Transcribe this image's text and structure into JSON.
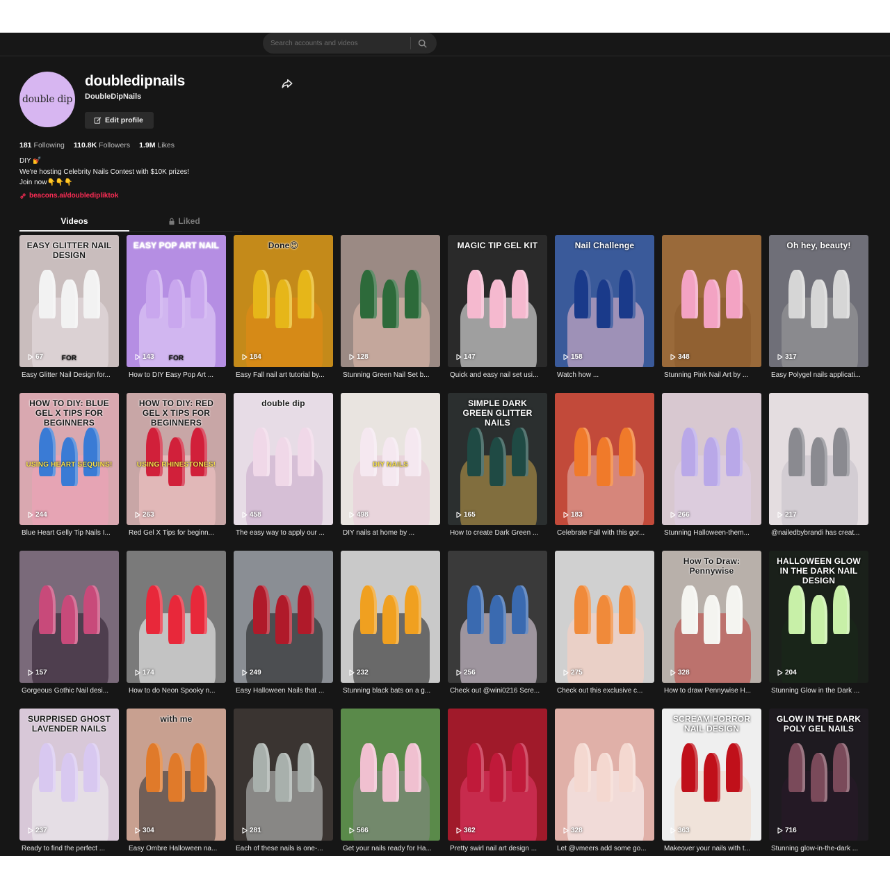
{
  "search": {
    "placeholder": "Search accounts and videos"
  },
  "profile": {
    "avatar_text": "double dip",
    "username": "doubledipnails",
    "nickname": "DoubleDipNails",
    "edit_label": "Edit profile"
  },
  "stats": {
    "following": "181",
    "following_label": "Following",
    "followers": "110.8K",
    "followers_label": "Followers",
    "likes": "1.9M",
    "likes_label": "Likes"
  },
  "bio": {
    "line1": "DIY 💅",
    "line2": "We're hosting Celebrity Nails Contest with $10K prizes!",
    "line3": "Join now👇👇👇",
    "link": "beacons.ai/doubledipliktok"
  },
  "tabs": {
    "videos": "Videos",
    "liked": "Liked"
  },
  "videos": [
    {
      "views": "67",
      "caption": "Easy Glitter Nail Design for...",
      "bg": "#c9bdbd",
      "overlay": "EASY GLITTER NAIL DESIGN",
      "overlay2": "FOR"
    },
    {
      "views": "143",
      "caption": "How to DIY Easy Pop Art ...",
      "bg": "#b58ee3",
      "overlay": "EASY POP ART NAIL",
      "overlay2": "FOR"
    },
    {
      "views": "184",
      "caption": "Easy Fall nail art tutorial by...",
      "bg": "#c48a1a",
      "overlay": "Done😍",
      "overlay2": ""
    },
    {
      "views": "128",
      "caption": "Stunning Green Nail Set b...",
      "bg": "#9b8a84",
      "overlay": "",
      "overlay2": ""
    },
    {
      "views": "147",
      "caption": "Quick and easy nail set usi...",
      "bg": "#2a2a2a",
      "overlay": "MAGIC TIP GEL KIT",
      "overlay2": ""
    },
    {
      "views": "158",
      "caption": "Watch how ...",
      "bg": "#3a5a9a",
      "overlay": "Nail Challenge",
      "overlay2": ""
    },
    {
      "views": "348",
      "caption": "Stunning Pink Nail Art by ...",
      "bg": "#9a6a3a",
      "overlay": "",
      "overlay2": ""
    },
    {
      "views": "317",
      "caption": "Easy Polygel nails applicati...",
      "bg": "#6f6f78",
      "overlay": "Oh hey, beauty!",
      "overlay2": ""
    },
    {
      "views": "244",
      "caption": "Blue Heart Gelly Tip Nails I...",
      "bg": "#d9a8b0",
      "overlay": "HOW TO DIY: BLUE GEL X TIPS FOR BEGINNERS",
      "overlay2": "USING HEART SEQUINS!"
    },
    {
      "views": "263",
      "caption": "Red Gel X Tips for beginn...",
      "bg": "#c8a6a6",
      "overlay": "HOW TO DIY: RED GEL X TIPS FOR BEGINNERS",
      "overlay2": "USING RHINESTONES!"
    },
    {
      "views": "458",
      "caption": "The easy way to apply our ...",
      "bg": "#e7dce6",
      "overlay": "double dip",
      "overlay2": ""
    },
    {
      "views": "498",
      "caption": "DIY nails at home by ...",
      "bg": "#e9e4e0",
      "overlay": "",
      "overlay2": "DIY NAILS"
    },
    {
      "views": "165",
      "caption": "How to create Dark Green ...",
      "bg": "#2b2f2f",
      "overlay": "SIMPLE DARK GREEN GLITTER NAILS",
      "overlay2": ""
    },
    {
      "views": "183",
      "caption": "Celebrate Fall with this gor...",
      "bg": "#c24a3a",
      "overlay": "",
      "overlay2": ""
    },
    {
      "views": "266",
      "caption": "Stunning Halloween-them...",
      "bg": "#d8c8d0",
      "overlay": "",
      "overlay2": ""
    },
    {
      "views": "217",
      "caption": "@nailedbybrandi has creat...",
      "bg": "#e4dde0",
      "overlay": "",
      "overlay2": ""
    },
    {
      "views": "157",
      "caption": "Gorgeous Gothic Nail desi...",
      "bg": "#7a6a7a",
      "overlay": "",
      "overlay2": ""
    },
    {
      "views": "174",
      "caption": "How to do Neon Spooky n...",
      "bg": "#7a7a7a",
      "overlay": "",
      "overlay2": ""
    },
    {
      "views": "249",
      "caption": "Easy Halloween Nails that ...",
      "bg": "#8a8e94",
      "overlay": "",
      "overlay2": ""
    },
    {
      "views": "232",
      "caption": "Stunning black bats on a g...",
      "bg": "#c9c9c9",
      "overlay": "",
      "overlay2": ""
    },
    {
      "views": "256",
      "caption": "Check out @wini0216 Scre...",
      "bg": "#3a3a3a",
      "overlay": "",
      "overlay2": ""
    },
    {
      "views": "275",
      "caption": "Check out this exclusive c...",
      "bg": "#d0d0d0",
      "overlay": "",
      "overlay2": ""
    },
    {
      "views": "328",
      "caption": "How to draw Pennywise H...",
      "bg": "#b8b0aa",
      "overlay": "How To Draw: Pennywise",
      "overlay2": ""
    },
    {
      "views": "204",
      "caption": "Stunning Glow in the Dark ...",
      "bg": "#1a201a",
      "overlay": "HALLOWEEN GLOW IN THE DARK NAIL DESIGN",
      "overlay2": ""
    },
    {
      "views": "237",
      "caption": "Ready to find the perfect ...",
      "bg": "#d8c8d8",
      "overlay": "SURPRISED GHOST LAVENDER NAILS",
      "overlay2": ""
    },
    {
      "views": "304",
      "caption": "Easy Ombre Halloween na...",
      "bg": "#c8a090",
      "overlay": "with me",
      "overlay2": ""
    },
    {
      "views": "281",
      "caption": "Each of these nails is one-...",
      "bg": "#3a3431",
      "overlay": "",
      "overlay2": ""
    },
    {
      "views": "566",
      "caption": "Get your nails ready for Ha...",
      "bg": "#5a8a4a",
      "overlay": "",
      "overlay2": ""
    },
    {
      "views": "362",
      "caption": "Pretty swirl nail art design ...",
      "bg": "#a01a2a",
      "overlay": "",
      "overlay2": ""
    },
    {
      "views": "328",
      "caption": "Let @vmeers add some go...",
      "bg": "#e0b0a8",
      "overlay": "",
      "overlay2": ""
    },
    {
      "views": "363",
      "caption": "Makeover your nails with t...",
      "bg": "#efefef",
      "overlay": "SCREAM HORROR NAIL DESIGN",
      "overlay2": ""
    },
    {
      "views": "716",
      "caption": "Stunning glow-in-the-dark ...",
      "bg": "#1e1a20",
      "overlay": "GLOW IN THE DARK POLY GEL NAILS",
      "overlay2": ""
    }
  ],
  "colors": {
    "accent": "#fe2c55",
    "background": "#161616",
    "avatar": "#d7b6f1"
  }
}
